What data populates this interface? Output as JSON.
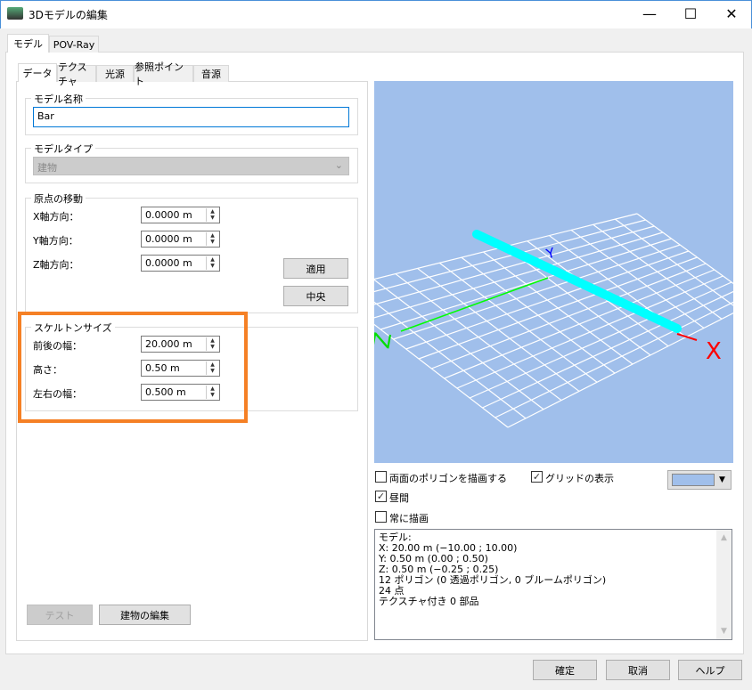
{
  "window": {
    "title": "3Dモデルの編集",
    "minimize": "—",
    "maximize": "☐",
    "close": "✕"
  },
  "outer_tabs": [
    {
      "label": "モデル"
    },
    {
      "label": "POV-Ray"
    }
  ],
  "inner_tabs": [
    {
      "label": "データ"
    },
    {
      "label": "テクスチャ"
    },
    {
      "label": "光源"
    },
    {
      "label": "参照ポイント"
    },
    {
      "label": "音源"
    }
  ],
  "model_name": {
    "label": "モデル名称",
    "value": "Bar"
  },
  "model_type": {
    "label": "モデルタイプ",
    "value": "建物"
  },
  "origin": {
    "label": "原点の移動",
    "rows": [
      {
        "label": "X軸方向：",
        "value": "0.0000 m"
      },
      {
        "label": "Y軸方向：",
        "value": "0.0000 m"
      },
      {
        "label": "Z軸方向：",
        "value": "0.0000 m"
      }
    ],
    "apply": "適用",
    "center": "中央"
  },
  "skeleton": {
    "label": "スケルトンサイズ",
    "rows": [
      {
        "label": "前後の幅：",
        "value": "20.000 m"
      },
      {
        "label": "高さ：",
        "value": "0.50 m"
      },
      {
        "label": "左右の幅：",
        "value": "0.500 m"
      }
    ]
  },
  "buttons": {
    "test": "テスト",
    "edit_building": "建物の編集",
    "ok": "確定",
    "cancel": "取消",
    "help": "ヘルプ"
  },
  "viewport": {
    "axis_x": "X",
    "axis_y": "Y",
    "axis_z": "Z",
    "bg_color": "#a0bfeb",
    "bar_color": "#00ffff"
  },
  "options": {
    "double_sided": {
      "label": "両面のポリゴンを描画する",
      "checked": false
    },
    "show_grid": {
      "label": "グリッドの表示",
      "checked": true
    },
    "daytime": {
      "label": "昼間",
      "checked": true
    },
    "always_draw": {
      "label": "常に描画",
      "checked": false
    },
    "color_swatch": "#a0bfeb"
  },
  "info_text": "モデル:\nX: 20.00 m (−10.00 ; 10.00)\nY: 0.50 m (0.00 ; 0.50)\nZ: 0.50 m (−0.25 ; 0.25)\n12 ポリゴン (0 透過ポリゴン, 0 ブルームポリゴン)\n24 点\nテクスチャ付き 0 部品"
}
